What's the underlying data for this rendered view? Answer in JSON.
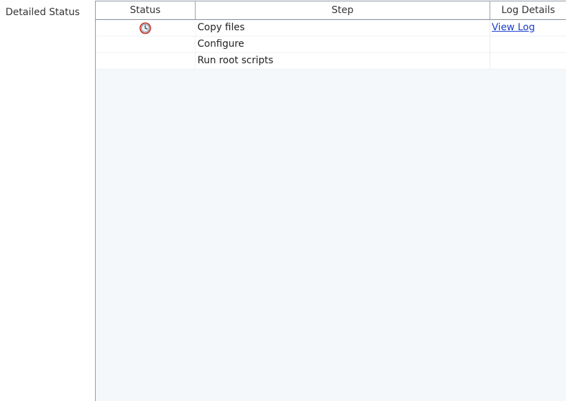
{
  "side_label": "Detailed Status",
  "table": {
    "columns": [
      "Status",
      "Step",
      "Log Details"
    ],
    "rows": [
      {
        "status_icon": "clock-icon",
        "step": "Copy files",
        "log": "View Log"
      },
      {
        "status_icon": "",
        "step": "Configure",
        "log": ""
      },
      {
        "status_icon": "",
        "step": "Run root scripts",
        "log": ""
      }
    ]
  },
  "colors": {
    "panel_bg": "#f4f8fa",
    "link": "#1a3ec9",
    "clock_ring": "#c0392b"
  }
}
